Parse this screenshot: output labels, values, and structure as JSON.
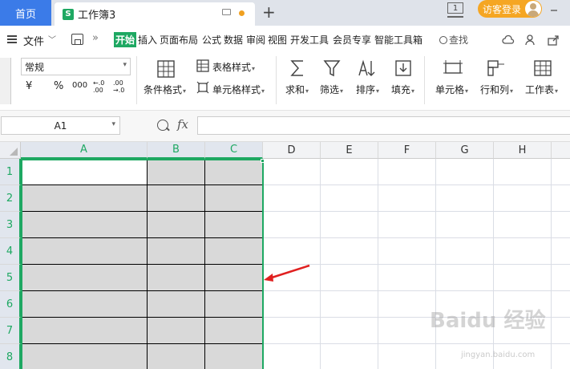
{
  "tabs": {
    "home": "首页",
    "doc_icon_letter": "S",
    "doc_title": "工作簿3",
    "add": "+",
    "page_count": "1",
    "login": "访客登录"
  },
  "menu": {
    "file": "文件",
    "chevron": "﹀",
    "more": "»",
    "tabs": [
      {
        "label": "开始",
        "active": true
      },
      {
        "label": "插入"
      },
      {
        "label": "页面布局"
      },
      {
        "label": "公式"
      },
      {
        "label": "数据"
      },
      {
        "label": "审阅"
      },
      {
        "label": "视图"
      },
      {
        "label": "开发工具"
      },
      {
        "label": "会员专享"
      },
      {
        "label": "智能工具箱"
      }
    ],
    "search": "查找"
  },
  "toolbar": {
    "number_format": "常规",
    "currency": "¥",
    "percent": "%",
    "thousands": "000",
    "dec_inc": "←.0 .00",
    "dec_dec": ".00 →.0",
    "conditional_format": "条件格式",
    "table_style": "表格样式",
    "cell_style": "单元格样式",
    "sum": "求和",
    "filter": "筛选",
    "sort": "排序",
    "fill": "填充",
    "cell": "单元格",
    "row_col": "行和列",
    "worksheet": "工作表"
  },
  "formula_bar": {
    "name_box": "A1",
    "fx": "fx",
    "formula": ""
  },
  "grid": {
    "columns": [
      "A",
      "B",
      "C",
      "D",
      "E",
      "F",
      "G",
      "H"
    ],
    "rows": [
      "1",
      "2",
      "3",
      "4",
      "5",
      "6",
      "7",
      "8"
    ],
    "selected_columns": [
      "A",
      "B",
      "C"
    ],
    "active_cell": "A1"
  },
  "watermark": {
    "text": "Baidu 经验",
    "url": "jingyan.baidu.com"
  },
  "colors": {
    "accent_green": "#1ea862",
    "home_tab_blue": "#3b7be8",
    "login_orange": "#f5a623",
    "selection_gray": "#d9d9d9",
    "arrow_red": "#e02020"
  }
}
